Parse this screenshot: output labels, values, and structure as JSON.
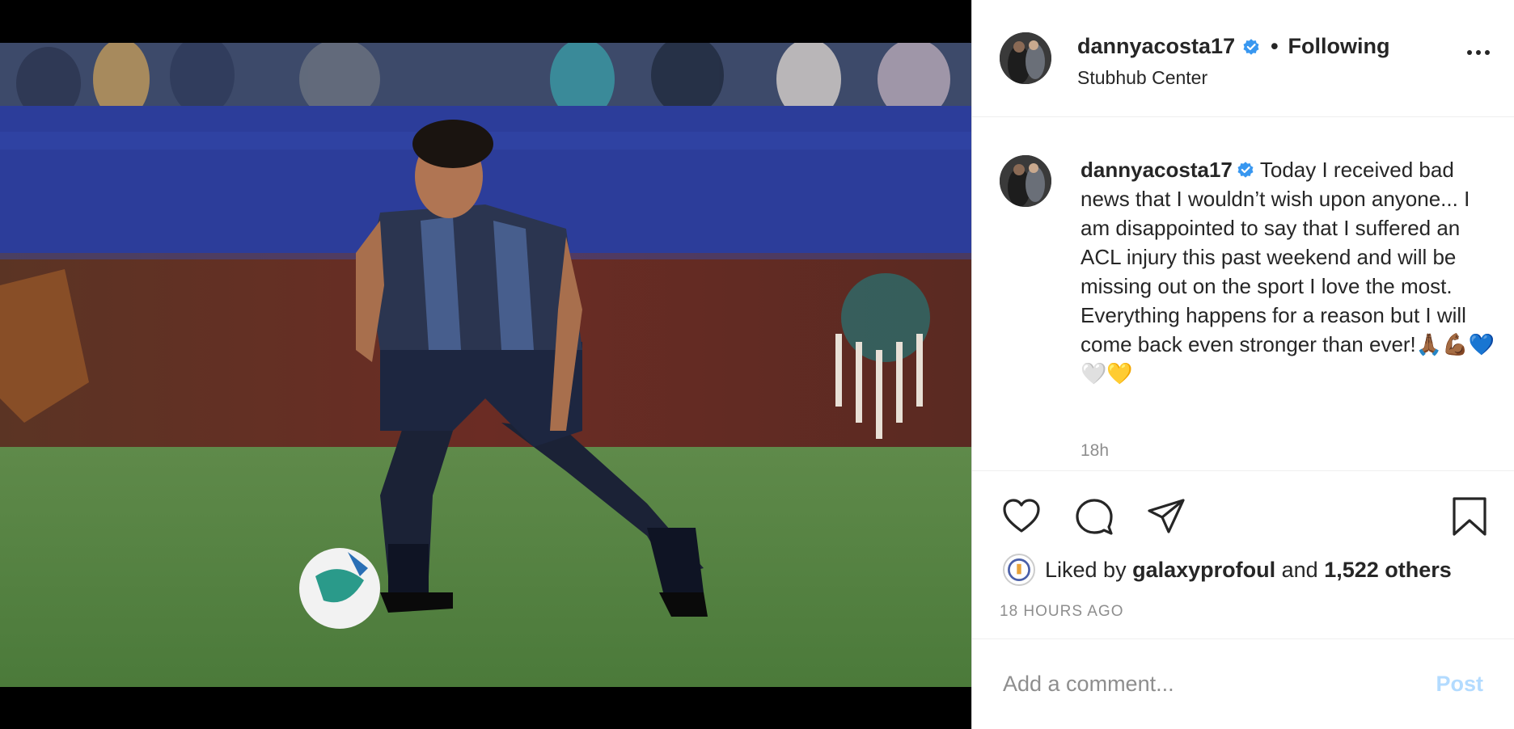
{
  "media": {
    "alt_icon": "soccer-player-photo"
  },
  "header": {
    "username": "dannyacosta17",
    "separator": "•",
    "follow_status": "Following",
    "location": "Stubhub Center",
    "verified_icon": "verified-badge-icon",
    "more_icon": "more-options-icon"
  },
  "caption": {
    "username": "dannyacosta17",
    "text": "Today I received bad news that I wouldn’t wish upon anyone... I am disappointed to say that I suffered an ACL injury this past weekend and will be missing out on the sport I love the most. Everything happens for a reason but I will come back even stronger than ever!🙏🏾💪🏾💙🤍💛",
    "time": "18h"
  },
  "actions": {
    "like_icon": "heart-icon",
    "comment_icon": "comment-icon",
    "share_icon": "send-icon",
    "save_icon": "bookmark-icon"
  },
  "likes": {
    "prefix": "Liked by",
    "user": "galaxyprofoul",
    "conjunction": "and",
    "others": "1,522 others"
  },
  "timestamp": "18 HOURS AGO",
  "comment": {
    "placeholder": "Add a comment...",
    "post_label": "Post"
  },
  "colors": {
    "verified_blue": "#3897f0",
    "post_disabled": "#b3dbff",
    "muted_text": "#8e8e8e"
  }
}
